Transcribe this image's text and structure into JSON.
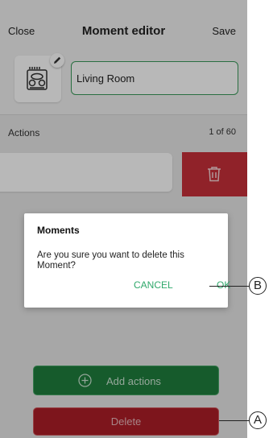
{
  "header": {
    "close_label": "Close",
    "title": "Moment editor",
    "save_label": "Save"
  },
  "moment": {
    "icon": "dining-table-icon",
    "edit_icon": "pencil-icon",
    "name_value": "Living Room"
  },
  "actions": {
    "label": "Actions",
    "count": "1 of 60",
    "delete_icon": "trash-icon"
  },
  "dialog": {
    "title": "Moments",
    "message": "Are you sure you want to delete this Moment?",
    "cancel_label": "CANCEL",
    "ok_label": "OK"
  },
  "buttons": {
    "add_actions_label": "Add actions",
    "add_icon": "plus-circle-icon",
    "delete_label": "Delete"
  },
  "callouts": {
    "a": "A",
    "b": "B"
  },
  "colors": {
    "accent_green": "#2fa86b",
    "delete_red": "#c8303a"
  }
}
